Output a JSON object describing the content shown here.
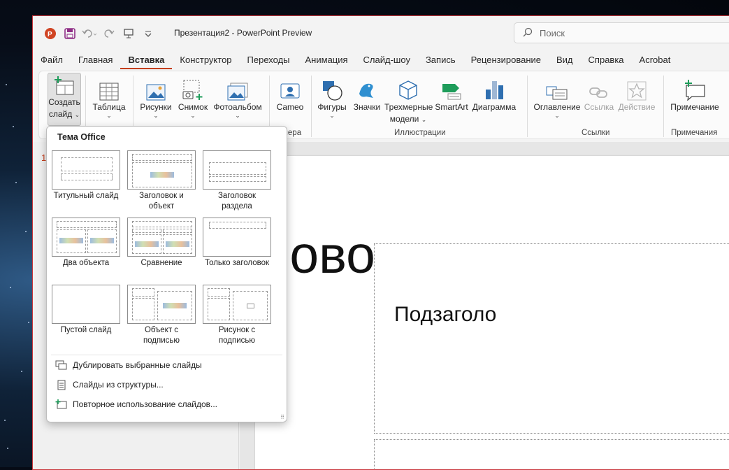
{
  "title_bar": {
    "document_title": "Презентация2  -  PowerPoint Preview",
    "search_placeholder": "Поиск"
  },
  "menu_tabs": [
    "Файл",
    "Главная",
    "Вставка",
    "Конструктор",
    "Переходы",
    "Анимация",
    "Слайд-шоу",
    "Запись",
    "Рецензирование",
    "Вид",
    "Справка",
    "Acrobat"
  ],
  "active_tab": "Вставка",
  "ribbon": {
    "new_slide": {
      "line1": "Создать",
      "line2": "слайд"
    },
    "table": "Таблица",
    "pictures": "Рисунки",
    "screenshot": "Снимок",
    "photo_album": "Фотоальбом",
    "cameo": "Cameo",
    "camera_group": "мера",
    "shapes": "Фигуры",
    "icons": "Значки",
    "models_3d": {
      "line1": "Трехмерные",
      "line2": "модели"
    },
    "smartart": "SmartArt",
    "chart": "Диаграмма",
    "illustrations_group": "Иллюстрации",
    "toc": "Оглавление",
    "link": "Ссылка",
    "action": "Действие",
    "links_group": "Ссылки",
    "comment": "Примечание",
    "comments_group": "Примечания"
  },
  "thumbnail_number": "1",
  "slide": {
    "title_placeholder": "Заголово",
    "subtitle_placeholder": "Подзаголо"
  },
  "gallery": {
    "heading": "Тема Office",
    "layouts": [
      {
        "line1": "Титульный слайд",
        "line2": ""
      },
      {
        "line1": "Заголовок и",
        "line2": "объект"
      },
      {
        "line1": "Заголовок",
        "line2": "раздела"
      },
      {
        "line1": "Два объекта",
        "line2": ""
      },
      {
        "line1": "Сравнение",
        "line2": ""
      },
      {
        "line1": "Только заголовок",
        "line2": ""
      },
      {
        "line1": "Пустой слайд",
        "line2": ""
      },
      {
        "line1": "Объект с",
        "line2": "подписью"
      },
      {
        "line1": "Рисунок с",
        "line2": "подписью"
      }
    ],
    "commands": [
      "Дублировать выбранные слайды",
      "Слайды из структуры...",
      "Повторное использование слайдов..."
    ]
  },
  "colors": {
    "accent": "#c43e1c",
    "brand_red": "#d04423",
    "save_purple": "#8f2e86",
    "icon_blue": "#2f6fb0",
    "icon_teal": "#1e9c8c"
  }
}
